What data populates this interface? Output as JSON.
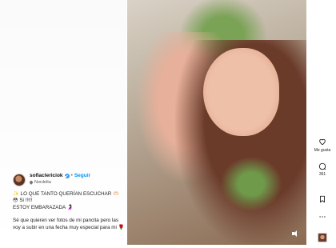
{
  "post": {
    "username": "sofiaclericiok",
    "separator": "•",
    "follow_label": "Seguir",
    "location": "Nordelta",
    "caption_line1": "✨ LO QUE TANTO QUERÍAN ESCUCHAR 🫶🏻",
    "caption_line2": "😳 Si !!!!!",
    "caption_line3": "ESTOY EMBARAZADA 🤰🏻",
    "caption_para2": "Sé que quieren ver fotos de mi pancita pero las voy a subir en una fecha muy especial para mi 🌹"
  },
  "rail": {
    "like_label": "Me gusta",
    "comment_count": "361"
  },
  "icons": {
    "verified": "verified-badge-icon",
    "location": "location-pin-icon",
    "like": "heart-icon",
    "comment": "comment-icon",
    "save": "bookmark-icon",
    "share": "share-icon",
    "audio": "volume-icon"
  },
  "colors": {
    "link_blue": "#0095f6",
    "verified_blue": "#3797f0"
  }
}
